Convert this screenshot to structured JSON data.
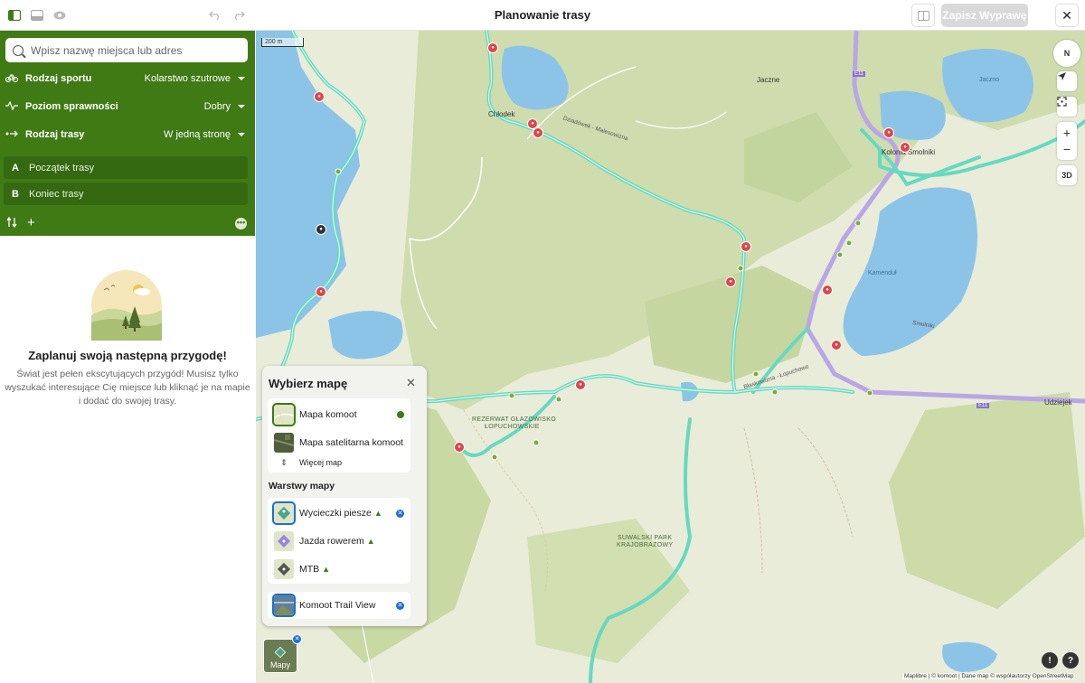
{
  "header": {
    "title": "Planowanie trasy",
    "save_label": "Zapisz Wyprawę"
  },
  "search": {
    "placeholder": "Wpisz nazwę miejsca lub adres"
  },
  "options": {
    "sport": {
      "label": "Rodzaj sportu",
      "value": "Kolarstwo szutrowe"
    },
    "fitness": {
      "label": "Poziom sprawności",
      "value": "Dobry"
    },
    "route_type": {
      "label": "Rodzaj trasy",
      "value": "W jedną stronę"
    }
  },
  "waypoints": [
    {
      "letter": "A",
      "label": "Początek trasy"
    },
    {
      "letter": "B",
      "label": "Koniec trasy"
    }
  ],
  "empty_state": {
    "title": "Zaplanuj swoją następną przygodę!",
    "text": "Świat jest pełen ekscytujących przygód! Musisz tylko wyszukać interesujące Cię miejsce lub kliknąć je na mapie i dodać do swojej trasy."
  },
  "map": {
    "scale_label": "200 m",
    "compass_label": "N",
    "three_d_label": "3D",
    "places": {
      "jaczne": "Jaczne",
      "jaczno": "Jaczno",
      "chlodek": "Chłodek",
      "kolonia": "Kolonia Smolniki",
      "kamenduł": "Kamenduł",
      "udziejek": "Udziejek",
      "reserve_line1": "REZERWAT GŁAZOWISKO",
      "reserve_line2": "ŁOPUCHOWSKIE",
      "park_line1": "SUWALSKI PARK",
      "park_line2": "KRAJOBRAZOWY",
      "road_e11_a": "E11",
      "road_e11_b": "E11",
      "street_1": "Dziadówek - Malesowizna",
      "street_2": "Błaskowizna - Łopuchowo",
      "street_3": "Smolniki"
    },
    "attribution": "Maplibre | © komoot | Dane map © współautorzy OpenStreetMap"
  },
  "map_chooser": {
    "title": "Wybierz mapę",
    "maps": [
      {
        "label": "Mapa komoot",
        "selected": true
      },
      {
        "label": "Mapa satelitarna komoot",
        "selected": false
      }
    ],
    "more_label": "Więcej map",
    "layers_title": "Warstwy mapy",
    "layers": [
      {
        "label": "Wycieczki piesze",
        "active": true
      },
      {
        "label": "Jazda rowerem",
        "active": false
      },
      {
        "label": "MTB",
        "active": false
      }
    ],
    "trail_view": {
      "label": "Komoot Trail View",
      "active": true
    },
    "button_label": "Mapy"
  },
  "colors": {
    "brand_green": "#3f7a14",
    "active_blue": "#1f6fd1",
    "trail": "#66d9c0",
    "water": "#8cc4e8"
  }
}
